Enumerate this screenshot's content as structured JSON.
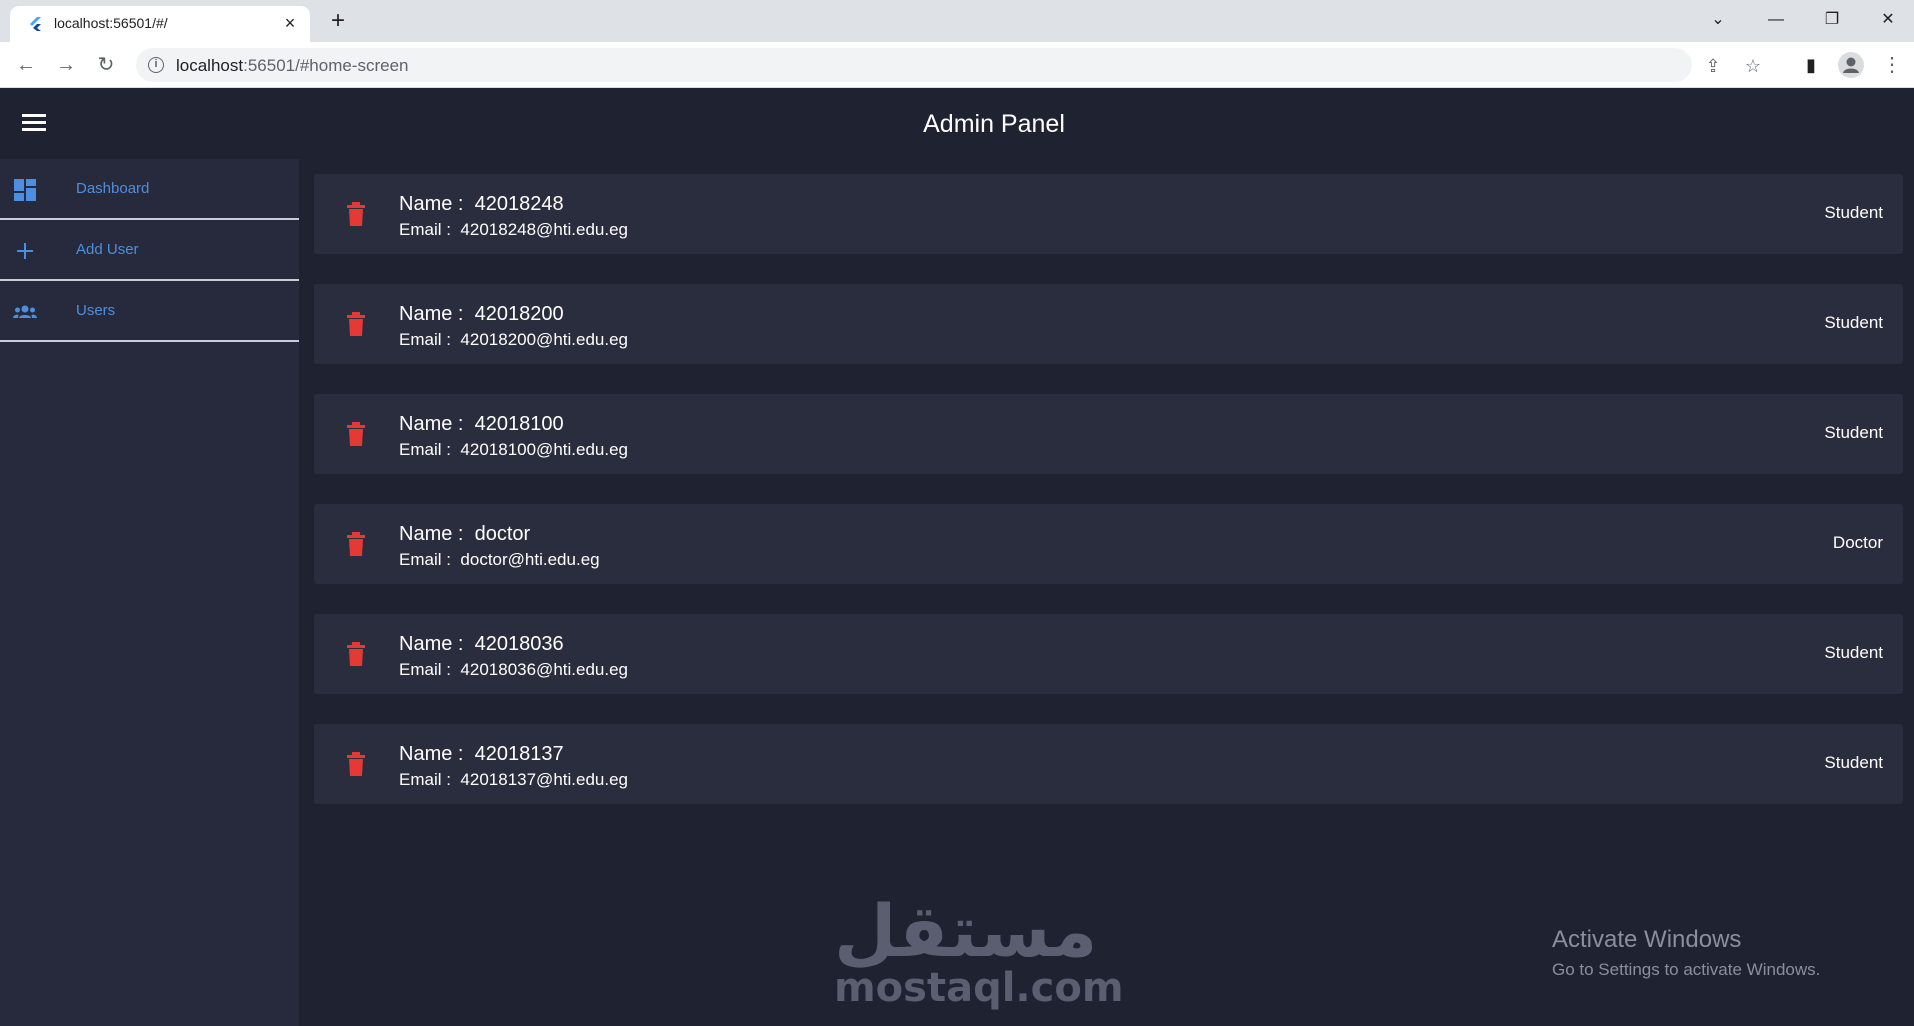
{
  "browser": {
    "tab_title": "localhost:56501/#/",
    "url_host": "localhost",
    "url_rest": ":56501/#home-screen",
    "new_tab": "+",
    "close_tab": "×"
  },
  "app": {
    "title": "Admin Panel"
  },
  "sidebar": {
    "items": [
      {
        "label": "Dashboard",
        "icon": "dashboard-icon"
      },
      {
        "label": "Add User",
        "icon": "plus-icon"
      },
      {
        "label": "Users",
        "icon": "group-icon"
      }
    ]
  },
  "users": [
    {
      "name_label": "Name :",
      "name": "42018248",
      "email_label": "Email :",
      "email": "42018248@hti.edu.eg",
      "role": "Student"
    },
    {
      "name_label": "Name :",
      "name": "42018200",
      "email_label": "Email :",
      "email": "42018200@hti.edu.eg",
      "role": "Student"
    },
    {
      "name_label": "Name :",
      "name": "42018100",
      "email_label": "Email :",
      "email": "42018100@hti.edu.eg",
      "role": "Student"
    },
    {
      "name_label": "Name :",
      "name": "doctor",
      "email_label": "Email :",
      "email": "doctor@hti.edu.eg",
      "role": "Doctor"
    },
    {
      "name_label": "Name :",
      "name": "42018036",
      "email_label": "Email :",
      "email": "42018036@hti.edu.eg",
      "role": "Student"
    },
    {
      "name_label": "Name :",
      "name": "42018137",
      "email_label": "Email :",
      "email": "42018137@hti.edu.eg",
      "role": "Student"
    }
  ],
  "watermark": {
    "arabic": "مستقل",
    "latin": "mostaql.com"
  },
  "os_notice": {
    "title": "Activate Windows",
    "subtitle": "Go to Settings to activate Windows."
  },
  "colors": {
    "accent": "#4a8fe0",
    "delete": "#e53935",
    "background": "#1f2230",
    "card": "#2a2d3d"
  }
}
